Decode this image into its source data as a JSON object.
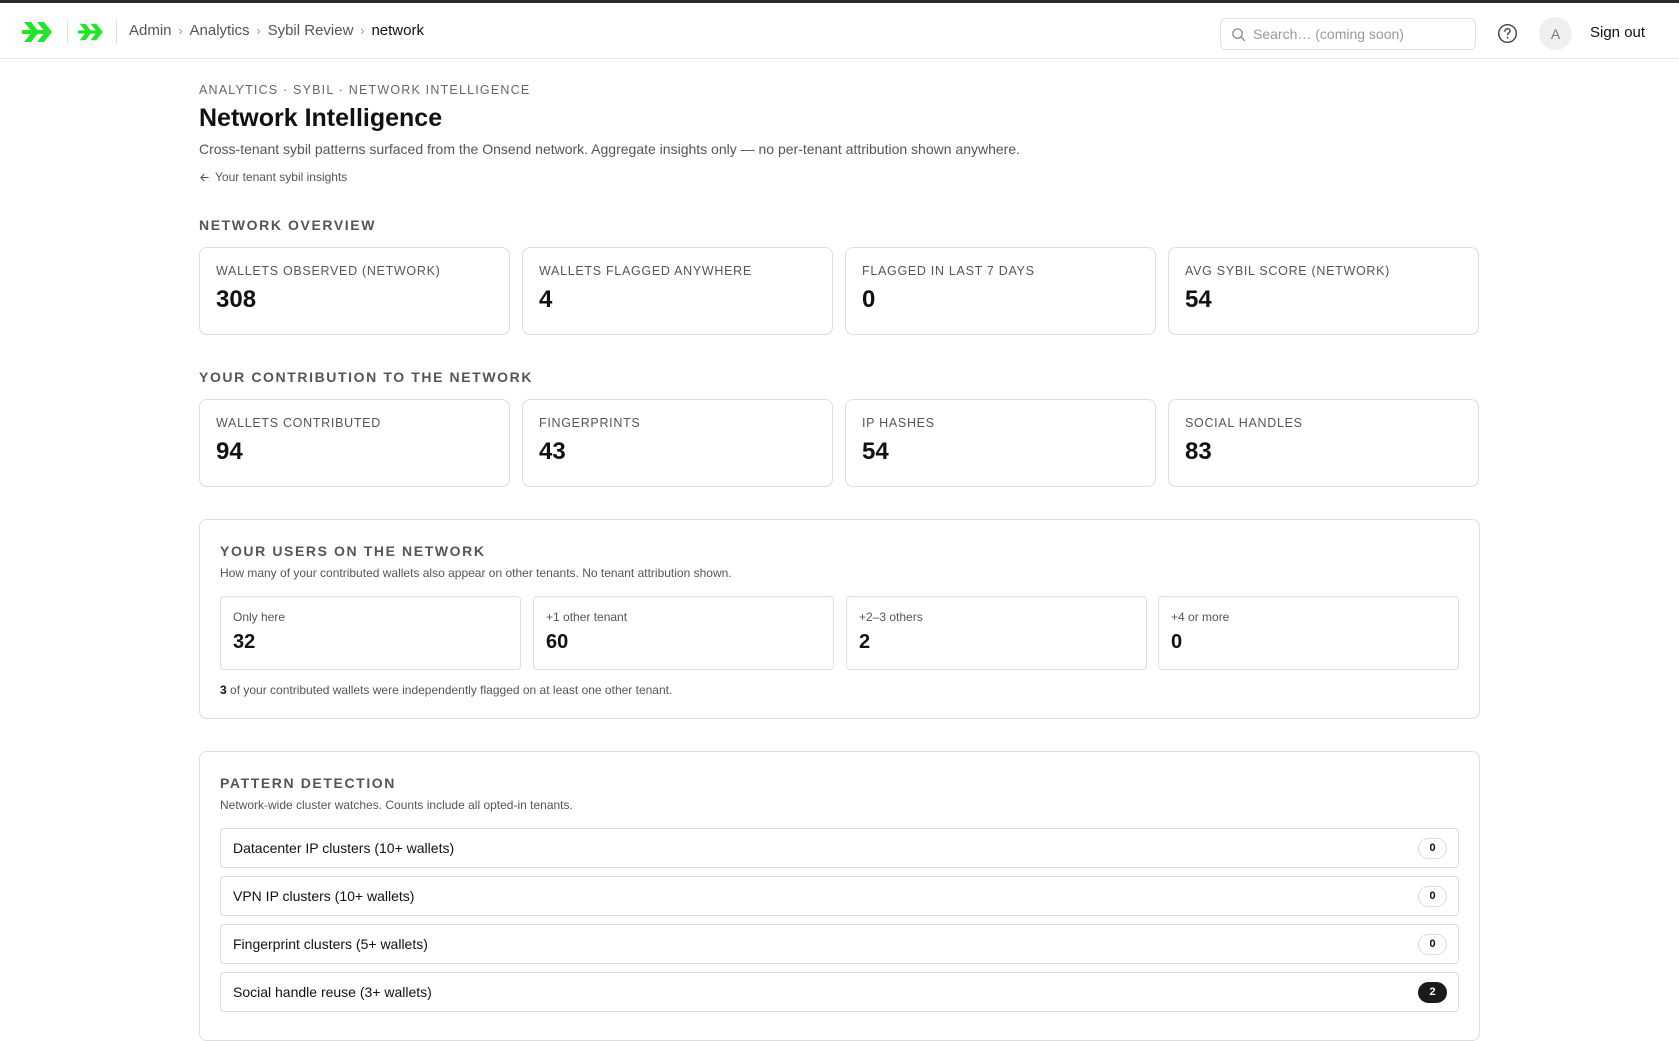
{
  "topbar": {
    "breadcrumbs": [
      "Admin",
      "Analytics",
      "Sybil Review",
      "network"
    ],
    "search_placeholder": "Search… (coming soon)",
    "avatar_initial": "A",
    "signout_label": "Sign out",
    "brand_color": "#22e52a"
  },
  "header": {
    "eyebrow": "ANALYTICS · SYBIL · NETWORK INTELLIGENCE",
    "title": "Network Intelligence",
    "subtitle": "Cross-tenant sybil patterns surfaced from the Onsend network. Aggregate insights only — no per-tenant attribution shown anywhere.",
    "back_link": "Your tenant sybil insights"
  },
  "overview": {
    "label": "NETWORK OVERVIEW",
    "cards": [
      {
        "label": "WALLETS OBSERVED (NETWORK)",
        "value": "308"
      },
      {
        "label": "WALLETS FLAGGED ANYWHERE",
        "value": "4"
      },
      {
        "label": "FLAGGED IN LAST 7 DAYS",
        "value": "0"
      },
      {
        "label": "AVG SYBIL SCORE (NETWORK)",
        "value": "54"
      }
    ]
  },
  "contribution": {
    "label": "YOUR CONTRIBUTION TO THE NETWORK",
    "cards": [
      {
        "label": "WALLETS CONTRIBUTED",
        "value": "94"
      },
      {
        "label": "FINGERPRINTS",
        "value": "43"
      },
      {
        "label": "IP HASHES",
        "value": "54"
      },
      {
        "label": "SOCIAL HANDLES",
        "value": "83"
      }
    ]
  },
  "users": {
    "title": "YOUR USERS ON THE NETWORK",
    "description": "How many of your contributed wallets also appear on other tenants. No tenant attribution shown.",
    "buckets": [
      {
        "label": "Only here",
        "value": "32"
      },
      {
        "label": "+1 other tenant",
        "value": "60"
      },
      {
        "label": "+2–3 others",
        "value": "2"
      },
      {
        "label": "+4 or more",
        "value": "0"
      }
    ],
    "note_count": "3",
    "note_text": " of your contributed wallets were independently flagged on at least one other tenant."
  },
  "patterns": {
    "title": "PATTERN DETECTION",
    "description": "Network-wide cluster watches. Counts include all opted-in tenants.",
    "rows": [
      {
        "label": "Datacenter IP clusters (10+ wallets)",
        "count": "0"
      },
      {
        "label": "VPN IP clusters (10+ wallets)",
        "count": "0"
      },
      {
        "label": "Fingerprint clusters (5+ wallets)",
        "count": "0"
      },
      {
        "label": "Social handle reuse (3+ wallets)",
        "count": "2"
      }
    ]
  }
}
